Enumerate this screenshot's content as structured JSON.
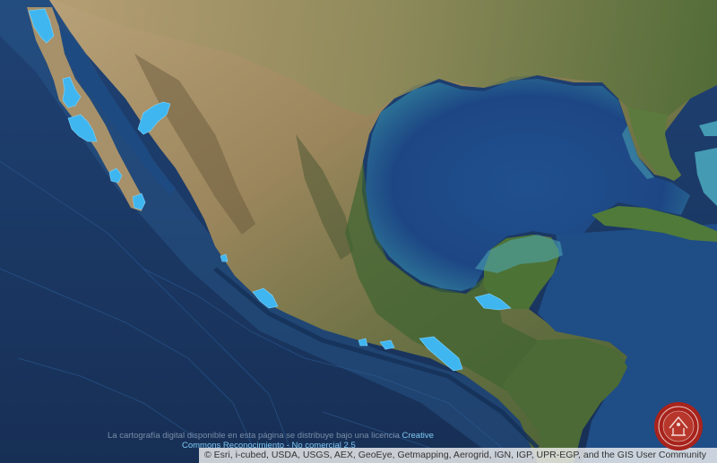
{
  "map": {
    "basemap": "satellite-imagery",
    "highlight_color": "#3fb6f0",
    "land_color": "#8a7a55",
    "ocean_color": "#1d3a63"
  },
  "license": {
    "text_prefix": "La cartografía digital disponible en esta página se distribuye bajo una licencia",
    "link_part1": "Creative",
    "link_part2": "Commons Reconocimiento - No comercial 2.5"
  },
  "attribution": {
    "text": "© Esri, i-cubed, USDA, USGS, AEX, GeoEye, Getmapping, Aerogrid, IGN, IGP, UPR-EGP, and the GIS User Community"
  },
  "logo": {
    "icon": "institution-seal-icon",
    "color": "#a8231c"
  }
}
